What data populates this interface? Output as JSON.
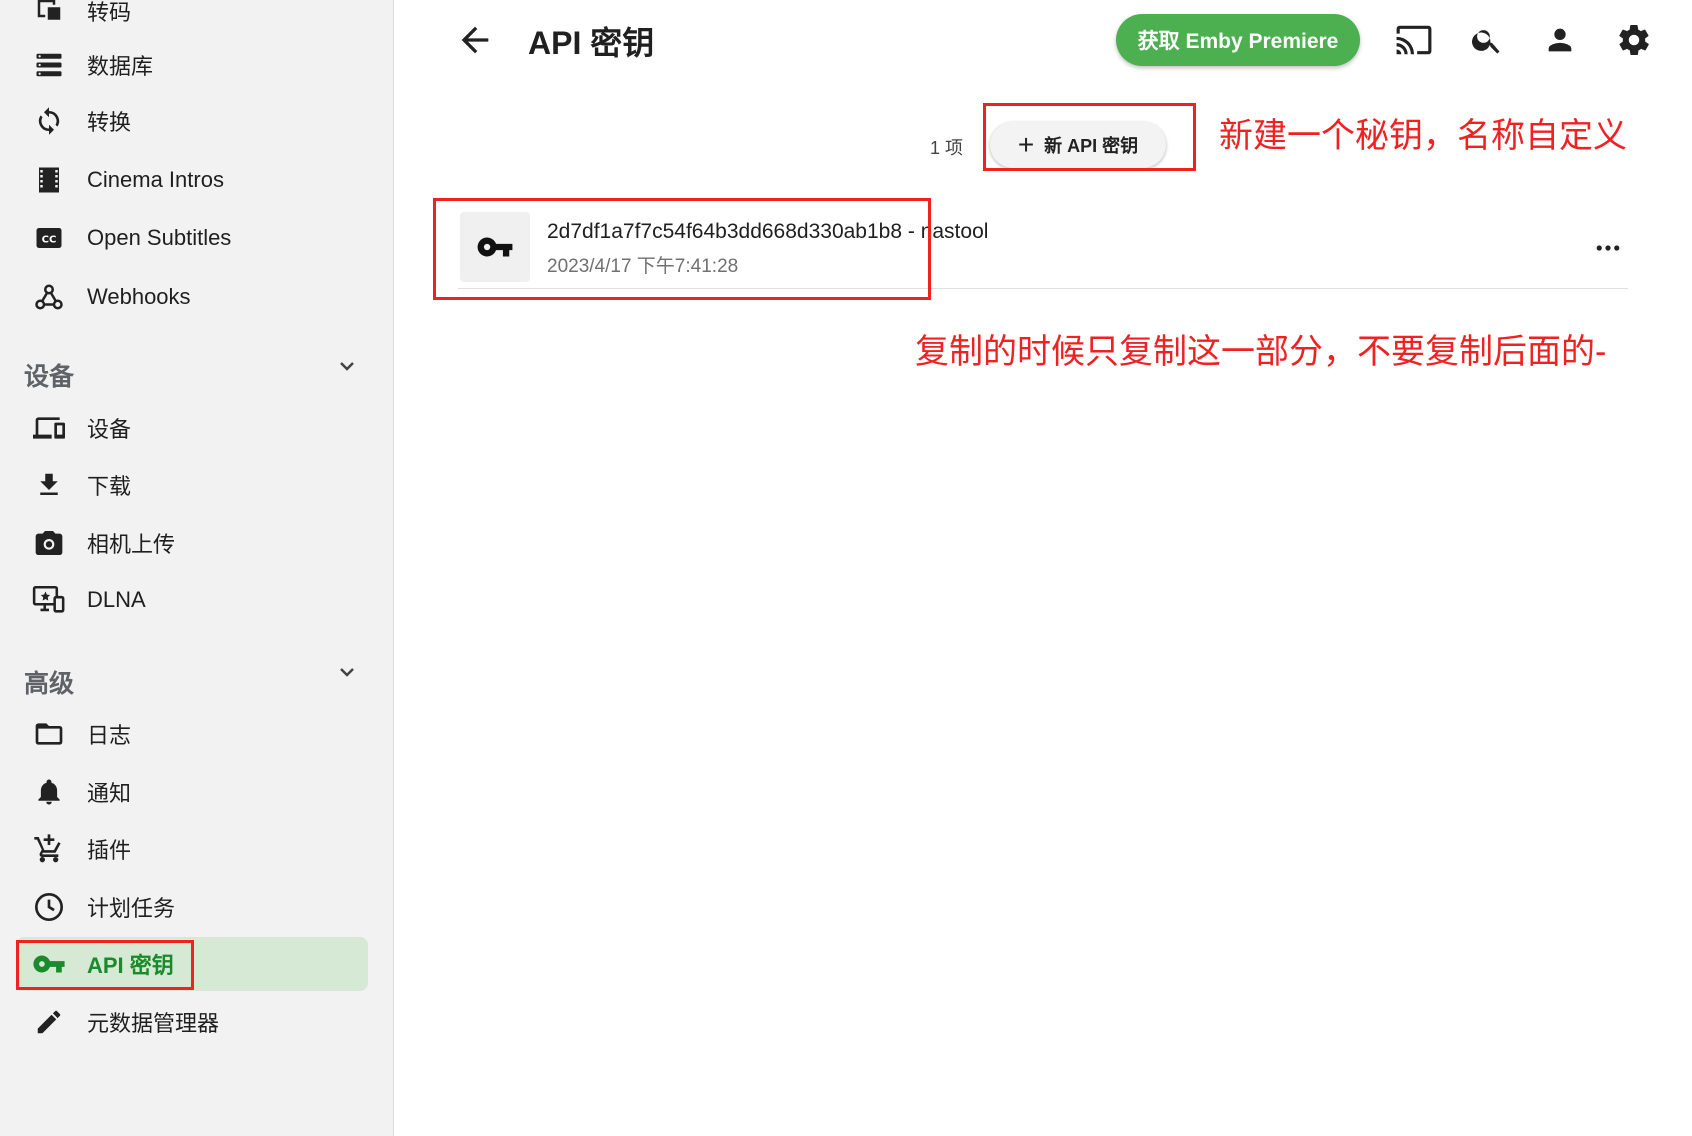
{
  "header": {
    "back_label": "back",
    "title": "API 密钥",
    "premiere_button": "获取 Emby Premiere"
  },
  "sidebar": {
    "items_top": [
      {
        "label": "转码",
        "icon": "transcode-icon"
      },
      {
        "label": "数据库",
        "icon": "database-icon"
      },
      {
        "label": "转换",
        "icon": "sync-icon"
      },
      {
        "label": "Cinema Intros",
        "icon": "film-icon"
      },
      {
        "label": "Open Subtitles",
        "icon": "cc-icon"
      },
      {
        "label": "Webhooks",
        "icon": "webhook-icon"
      }
    ],
    "section_devices": {
      "title": "设备",
      "items": [
        {
          "label": "设备",
          "icon": "devices-icon"
        },
        {
          "label": "下载",
          "icon": "download-icon"
        },
        {
          "label": "相机上传",
          "icon": "camera-icon"
        },
        {
          "label": "DLNA",
          "icon": "dlna-icon"
        }
      ]
    },
    "section_advanced": {
      "title": "高级",
      "items": [
        {
          "label": "日志",
          "icon": "folder-icon"
        },
        {
          "label": "通知",
          "icon": "bell-icon"
        },
        {
          "label": "插件",
          "icon": "cart-icon"
        },
        {
          "label": "计划任务",
          "icon": "clock-icon"
        },
        {
          "label": "API 密钥",
          "icon": "key-icon",
          "active": true
        },
        {
          "label": "元数据管理器",
          "icon": "pencil-icon"
        }
      ]
    }
  },
  "content": {
    "count": "1 项",
    "new_key_button": "新 API 密钥",
    "keys": [
      {
        "key": "2d7df1a7f7c54f64b3dd668d330ab1b8",
        "separator": " - ",
        "app": "nastool",
        "date": "2023/4/17 下午7:41:28"
      }
    ]
  },
  "annotations": {
    "new_key_note": "新建一个秘钥，名称自定义",
    "copy_note": "复制的时候只复制这一部分，不要复制后面的-"
  },
  "colors": {
    "accent": "#4caf50",
    "active_bg": "#d5e9d5",
    "active_text": "#1b8a2c",
    "annotation": "#ee2222"
  }
}
